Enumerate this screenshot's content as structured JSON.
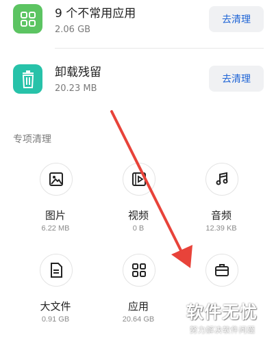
{
  "rows": [
    {
      "title": "9 个不常用应用",
      "subtitle": "2.06 GB",
      "button_label": "去清理",
      "icon": "grid-apps-icon",
      "icon_color": "#5cc462"
    },
    {
      "title": "卸载残留",
      "subtitle": "20.23 MB",
      "button_label": "去清理",
      "icon": "trash-icon",
      "icon_color": "#27c2a9"
    }
  ],
  "section": {
    "title": "专项清理"
  },
  "tiles": [
    {
      "label": "图片",
      "size": "6.22 MB",
      "icon": "image-icon"
    },
    {
      "label": "视频",
      "size": "0 B",
      "icon": "video-icon"
    },
    {
      "label": "音频",
      "size": "12.39 KB",
      "icon": "music-note-icon"
    },
    {
      "label": "大文件",
      "size": "0.91 GB",
      "icon": "document-icon"
    },
    {
      "label": "应用",
      "size": "20.64 GB",
      "icon": "apps-grid-icon"
    },
    {
      "label": "",
      "size": "",
      "icon": "briefcase-icon"
    }
  ],
  "watermark": {
    "title": "软件无忧",
    "subtitle": "努力解决软件问题"
  },
  "colors": {
    "accent_blue": "#1e64d6",
    "annotation_arrow": "#e8433a"
  }
}
